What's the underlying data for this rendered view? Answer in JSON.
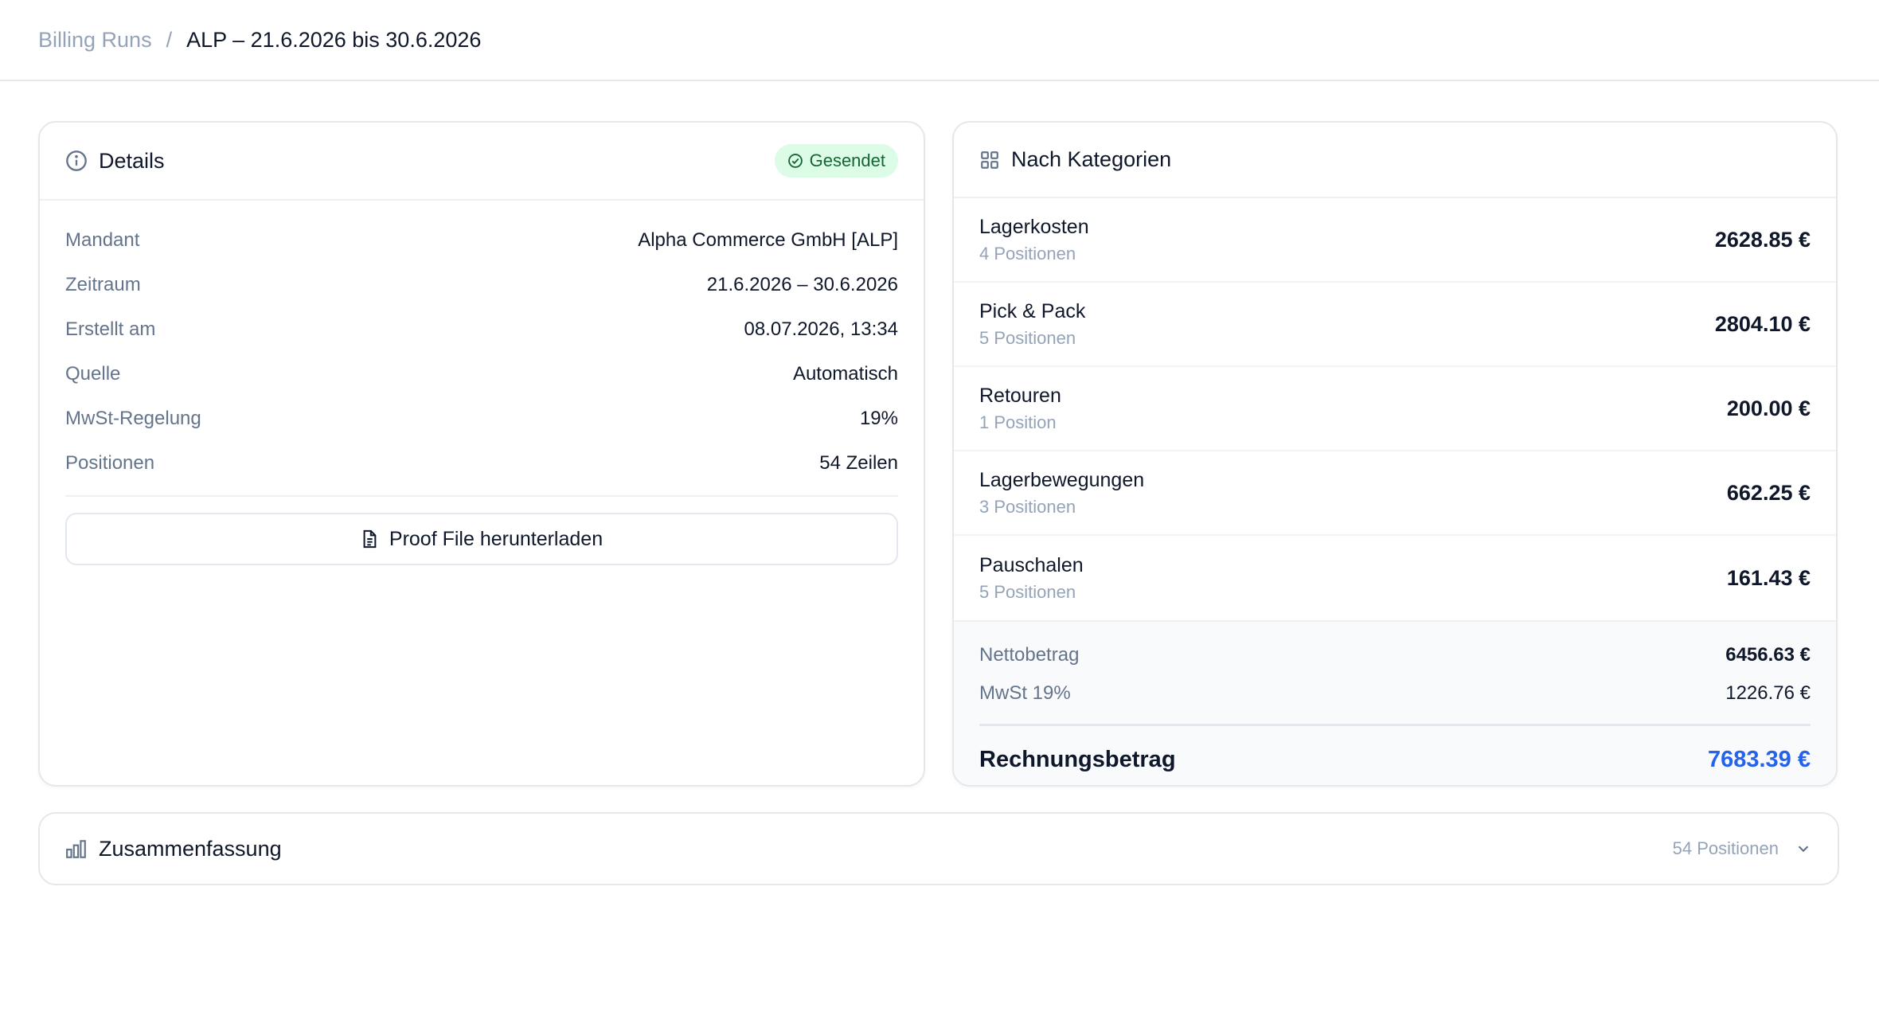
{
  "breadcrumb": {
    "root": "Billing Runs",
    "separator": "/",
    "current": "ALP – 21.6.2026 bis 30.6.2026"
  },
  "details": {
    "title": "Details",
    "status": "Gesendet",
    "rows": [
      {
        "label": "Mandant",
        "value": "Alpha Commerce GmbH [ALP]"
      },
      {
        "label": "Zeitraum",
        "value": "21.6.2026 – 30.6.2026"
      },
      {
        "label": "Erstellt am",
        "value": "08.07.2026, 13:34"
      },
      {
        "label": "Quelle",
        "value": "Automatisch"
      },
      {
        "label": "MwSt-Regelung",
        "value": "19%"
      },
      {
        "label": "Positionen",
        "value": "54 Zeilen"
      }
    ],
    "download_label": "Proof File herunterladen"
  },
  "categories": {
    "title": "Nach Kategorien",
    "items": [
      {
        "name": "Lagerkosten",
        "count": "4 Positionen",
        "amount": "2628.85 €"
      },
      {
        "name": "Pick & Pack",
        "count": "5 Positionen",
        "amount": "2804.10 €"
      },
      {
        "name": "Retouren",
        "count": "1 Position",
        "amount": "200.00 €"
      },
      {
        "name": "Lagerbewegungen",
        "count": "3 Positionen",
        "amount": "662.25 €"
      },
      {
        "name": "Pauschalen",
        "count": "5 Positionen",
        "amount": "161.43 €"
      }
    ],
    "net_label": "Nettobetrag",
    "net_value": "6456.63 €",
    "vat_label": "MwSt 19%",
    "vat_value": "1226.76 €",
    "total_label": "Rechnungsbetrag",
    "total_value": "7683.39 €"
  },
  "summary": {
    "title": "Zusammenfassung",
    "count": "54 Positionen"
  },
  "colors": {
    "accent": "#2563eb",
    "status_bg": "#dcfce7",
    "status_fg": "#166534"
  },
  "icons": {
    "details": "info-icon",
    "status": "check-circle-icon",
    "download": "file-icon",
    "categories": "grid-icon",
    "summary": "bar-chart-icon",
    "expand": "chevron-down-icon"
  }
}
